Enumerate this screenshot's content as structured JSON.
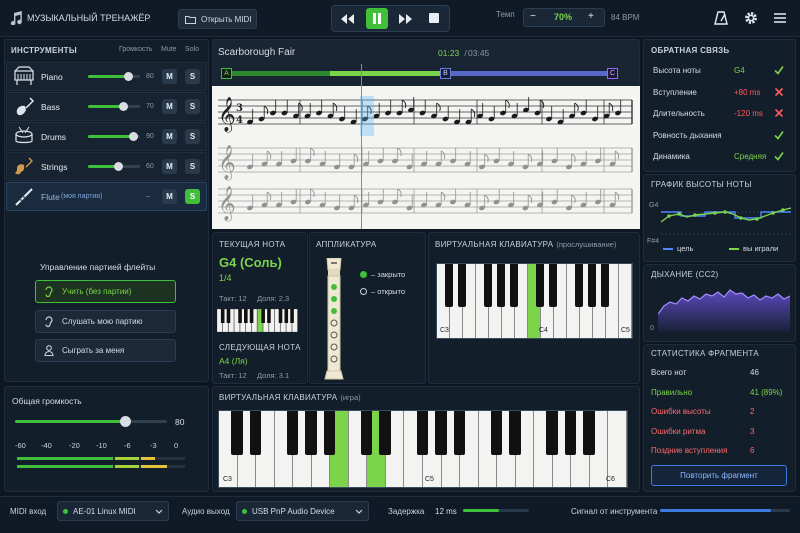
{
  "header": {
    "app_title": "МУЗЫКАЛЬНЫЙ ТРЕНАЖЁР",
    "open_midi": "Открыть MIDI",
    "tempo_label": "Темп",
    "tempo_value": "70%",
    "bpm": "84 BPM",
    "minus": "−",
    "plus": "+"
  },
  "instruments": {
    "title": "ИНСТРУМЕНТЫ",
    "col_volume": "Громкость",
    "col_mute": "Mute",
    "col_solo": "Solo",
    "items": [
      {
        "name": "Piano",
        "vol": 80,
        "vol_label": "80"
      },
      {
        "name": "Bass",
        "vol": 70,
        "vol_label": "70"
      },
      {
        "name": "Drums",
        "vol": 90,
        "vol_label": "90"
      },
      {
        "name": "Strings",
        "vol": 60,
        "vol_label": "60"
      },
      {
        "name": "Flute",
        "tag": "(моя партия)",
        "vol_label": "–"
      }
    ],
    "mute": "M",
    "solo": "S"
  },
  "flute": {
    "title": "Управление партией флейты",
    "learn": "Учить (без партии)",
    "listen": "Слушать мою партию",
    "play_for_me": "Сыграть за меня"
  },
  "master": {
    "title": "Общая громкость",
    "value": "80",
    "level": 80,
    "db": [
      "-60",
      "-40",
      "-20",
      "-10",
      "-6",
      "-3",
      "0"
    ]
  },
  "score": {
    "title": "Scarborough Fair",
    "time_now": "01:23",
    "time_sep": " / ",
    "time_total": "03:45",
    "marker_a": "A",
    "marker_b": "B",
    "marker_c": "C",
    "progress": 0.37
  },
  "current": {
    "title": "ТЕКУЩАЯ НОТА",
    "note": "G4 (Соль)",
    "fraction": "1/4",
    "bar_label": "Такт: 12",
    "beat_label": "Доля: 2.3",
    "next_title": "СЛЕДУЮЩАЯ НОТА",
    "next_note": "A4 (Ля)",
    "next_bar": "Такт: 12",
    "next_beat": "Доля: 3.1"
  },
  "fingering": {
    "title": "АППЛИКАТУРА",
    "closed": "– закрыто",
    "open": "– открыто"
  },
  "vkeys_listen": {
    "title": "ВИРТУАЛЬНАЯ КЛАВИАТУРА",
    "sub": "(прослушивание)",
    "c3": "C3",
    "c4": "C4",
    "c5": "C5"
  },
  "vkeys_play": {
    "title": "ВИРТУАЛЬНАЯ КЛАВИАТУРА",
    "sub": "(игра)",
    "c3": "C3",
    "c5": "C5",
    "c6": "C6"
  },
  "feedback": {
    "title": "ОБРАТНАЯ СВЯЗЬ",
    "rows": [
      {
        "label": "Высота ноты",
        "value": "G4",
        "status": "ok"
      },
      {
        "label": "Вступление",
        "value": "+80 ms",
        "status": "bad"
      },
      {
        "label": "Длительность",
        "value": "-120 ms",
        "status": "bad"
      },
      {
        "label": "Ровность дыхания",
        "value": "",
        "status": "ok"
      },
      {
        "label": "Динамика",
        "value": "Средняя",
        "status": "ok"
      }
    ]
  },
  "pitch": {
    "title": "ГРАФИК ВЫСОТЫ НОТЫ",
    "g4": "G4",
    "fs4": "F#4",
    "legend_target": "цель",
    "legend_played": "вы играли"
  },
  "breath": {
    "title": "ДЫХАНИЕ (CC2)",
    "zero": "0"
  },
  "stats": {
    "title": "СТАТИСТИКА ФРАГМЕНТА",
    "rows": [
      {
        "label": "Всего нот",
        "value": "46",
        "kind": "plain"
      },
      {
        "label": "Правильно",
        "value": "41 (89%)",
        "kind": "good"
      },
      {
        "label": "Ошибки высоты",
        "value": "2",
        "kind": "bad"
      },
      {
        "label": "Ошибки ритма",
        "value": "3",
        "kind": "bad"
      },
      {
        "label": "Поздние вступления",
        "value": "6",
        "kind": "bad"
      }
    ],
    "repeat": "Повторить фрагмент"
  },
  "footer": {
    "midi_in_label": "MIDI вход",
    "midi_in": "AE-01 Linux MIDI",
    "audio_out_label": "Аудио выход",
    "audio_out": "USB PnP Audio Device",
    "latency_label": "Задержка",
    "latency": "12 ms",
    "signal_label": "Сигнал от инструмента",
    "latency_level": 0.55,
    "signal_level": 0.85
  },
  "colors": {
    "accent": "#7bd44a",
    "bg": "#0d1622",
    "panel": "#131e2b",
    "error": "#ff5b5b",
    "purple": "#8a6bff"
  }
}
